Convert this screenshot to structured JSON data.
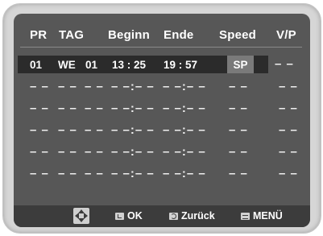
{
  "header": {
    "pr": "PR",
    "tag": "TAG",
    "beginn": "Beginn",
    "ende": "Ende",
    "speed": "Speed",
    "vp": "V/P"
  },
  "rows": [
    {
      "pr": "01",
      "tag": "WE",
      "day": "01",
      "beginn": "13 : 25",
      "ende": "19 : 57",
      "speed": "SP",
      "vp": "– –"
    },
    {
      "pr": "– –",
      "tag": "– –",
      "day": "– –",
      "beginn": "– –:– –",
      "ende": "– –:– –",
      "speed": "– –",
      "vp": "– –"
    },
    {
      "pr": "– –",
      "tag": "– –",
      "day": "– –",
      "beginn": "– –:– –",
      "ende": "– –:– –",
      "speed": "– –",
      "vp": "– –"
    },
    {
      "pr": "– –",
      "tag": "– –",
      "day": "– –",
      "beginn": "– –:– –",
      "ende": "– –:– –",
      "speed": "– –",
      "vp": "– –"
    },
    {
      "pr": "– –",
      "tag": "– –",
      "day": "– –",
      "beginn": "– –:– –",
      "ende": "– –:– –",
      "speed": "– –",
      "vp": "– –"
    },
    {
      "pr": "– –",
      "tag": "– –",
      "day": "– –",
      "beginn": "– –:– –",
      "ende": "– –:– –",
      "speed": "– –",
      "vp": "– –"
    }
  ],
  "footer": {
    "ok_label": "OK",
    "back_label": "Zurück",
    "menu_label": "MENÜ"
  },
  "colors": {
    "screen": "#575757",
    "active_row": "#2b2b2b",
    "speed_highlight": "#7a7a7a",
    "footer": "#3c3c3c"
  }
}
